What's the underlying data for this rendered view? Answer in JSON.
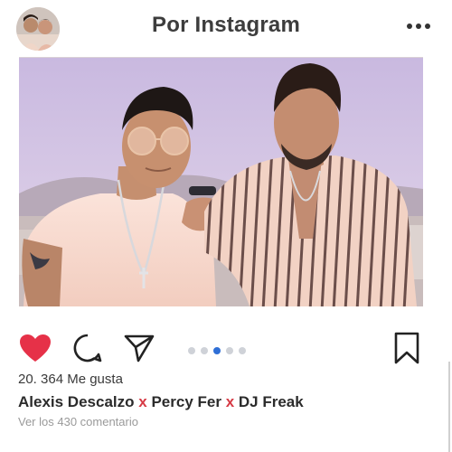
{
  "header": {
    "title": "Por Instagram",
    "avatar_icon": "profile-avatar",
    "more_icon": "more-horizontal-icon"
  },
  "post": {
    "image_icon": "post-photo",
    "carousel": {
      "count": 5,
      "active_index": 2
    },
    "actions": {
      "like_icon": "heart-filled-icon",
      "comment_icon": "comment-icon",
      "share_icon": "send-icon",
      "save_icon": "bookmark-icon"
    },
    "likes_text": "20. 364 Me gusta",
    "caption": {
      "artist1": "Alexis Descalzo",
      "sep1": "x",
      "artist2": "Percy Fer",
      "sep2": "x",
      "artist3": "DJ Freak"
    },
    "comments_link": "Ver los 430 comentario"
  },
  "colors": {
    "heart": "#e63148",
    "accent_x": "#d63a45",
    "active_dot": "#2f6fd6",
    "inactive_dot": "#cfd2d8"
  }
}
